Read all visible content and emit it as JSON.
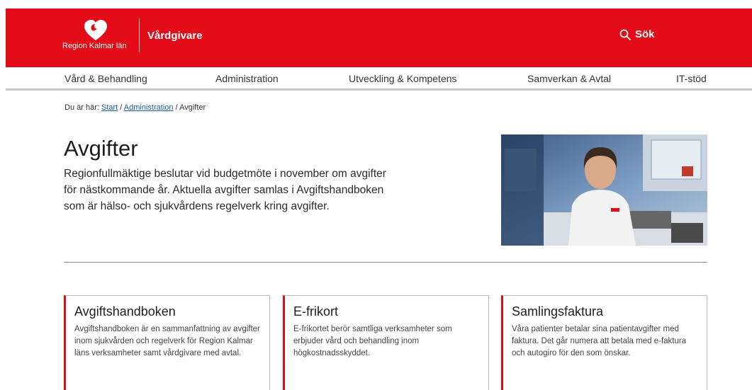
{
  "header": {
    "logo_text": "Region Kalmar län",
    "site_name": "Vårdgivare",
    "search_label": "Sök"
  },
  "nav": {
    "items": [
      "Vård & Behandling",
      "Administration",
      "Utveckling & Kompetens",
      "Samverkan & Avtal",
      "IT-stöd"
    ]
  },
  "breadcrumb": {
    "prefix": "Du är här:",
    "items": [
      "Start",
      "Administration"
    ],
    "separator": "/",
    "current": "Avgifter"
  },
  "page": {
    "title": "Avgifter",
    "intro": "Regionfullmäktige beslutar vid budgetmöte i november om avgifter för nästkommande år. Aktuella avgifter samlas i Avgiftshandboken som är hälso- och sjukvårdens regelverk kring avgifter."
  },
  "cards": [
    {
      "title": "Avgiftshandboken",
      "text": "Avgiftshandboken är en sammanfattning av avgifter inom sjukvården och regelverk för Region Kalmar läns verksamheter samt vårdgivare med avtal."
    },
    {
      "title": "E-frikort",
      "text": "E-frikortet berör samtliga verksamheter som erbjuder vård och behandling inom högkostnadsskyddet."
    },
    {
      "title": "Samlingsfaktura",
      "text": "Våra patienter betalar sina patientavgifter med faktura. Det går numera att betala med e-faktura och autogiro för den som önskar."
    }
  ],
  "colors": {
    "brand_red": "#e30b17",
    "link": "#1a5ca6"
  },
  "icons": {
    "search": "magnifier-icon",
    "logo": "heart-logo-icon"
  }
}
